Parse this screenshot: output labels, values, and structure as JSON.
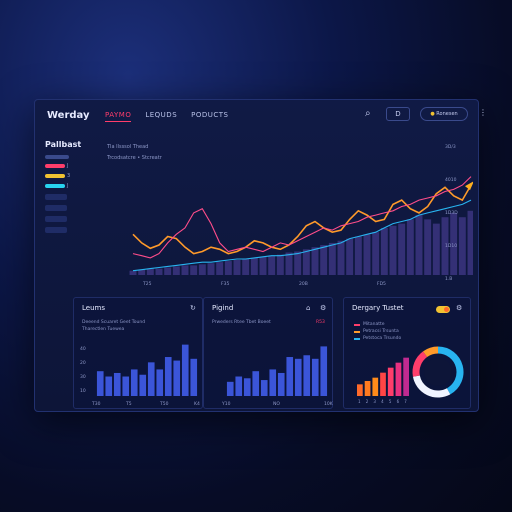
{
  "app": {
    "brand": "Werday",
    "nav": [
      {
        "label": "PAYMO",
        "active": true
      },
      {
        "label": "LEQUDS",
        "active": false
      },
      {
        "label": "PODUCTS",
        "active": false
      }
    ],
    "toolbar_button": "D",
    "user_pill": "Ronesen"
  },
  "sidebar": {
    "title": "Pallbast",
    "items": [
      {
        "color": "#ff3d6b",
        "mark": "J"
      },
      {
        "color": "#f1c232",
        "mark": "3"
      },
      {
        "color": "#28d3f0",
        "mark": "J"
      }
    ]
  },
  "main": {
    "heading": "Tla   Ilsssol  Thead",
    "subheading": "Trcodsatcre • Stcreatr",
    "x_ticks": [
      "T25",
      "F35",
      "20B",
      "FD5"
    ],
    "y_ticks": [
      "3D/3",
      "4010",
      "1D3D",
      "1D10",
      "1.B"
    ]
  },
  "panels": {
    "left_title": "Leums",
    "left_sub1": "Deeend  Scuaret  Geet Tound",
    "left_sub2": "Tharectlen  Tuewea",
    "left_y": [
      "40",
      "20",
      "30",
      "10"
    ],
    "left_x": [
      "T30",
      "T5",
      "T50",
      "K4"
    ],
    "middle_title": "Pigind",
    "middle_sub1": "Prweders  Rtee Tbet Boeet",
    "middle_badge": "R53",
    "middle_x": [
      "Y10",
      "NO",
      "10K"
    ],
    "right_title": "Dergary Tustet",
    "right_legend": [
      "Mitanatte",
      "Petracsi Trsunta",
      "Petstoca Trsundo"
    ],
    "right_x": [
      "1",
      "2",
      "3",
      "4",
      "5",
      "6",
      "7"
    ]
  },
  "chart_data": [
    {
      "type": "line",
      "title": "",
      "xlabel": "",
      "ylabel": "",
      "x": [
        1,
        2,
        3,
        4,
        5,
        6,
        7,
        8,
        9,
        10,
        11,
        12,
        13,
        14,
        15,
        16,
        17,
        18,
        19,
        20,
        21,
        22,
        23,
        24,
        25,
        26,
        27,
        28,
        29,
        30,
        31,
        32,
        33,
        34,
        35,
        36,
        37,
        38,
        39,
        40
      ],
      "ylim": [
        0,
        100
      ],
      "series": [
        {
          "values": [
            38,
            30,
            25,
            28,
            36,
            34,
            26,
            20,
            22,
            26,
            24,
            20,
            22,
            26,
            32,
            30,
            26,
            24,
            28,
            36,
            46,
            50,
            44,
            40,
            42,
            52,
            60,
            56,
            50,
            52,
            66,
            70,
            62,
            58,
            64,
            76,
            82,
            74,
            70,
            84
          ],
          "color": "#ff9a2a"
        },
        {
          "values": [
            20,
            18,
            16,
            20,
            30,
            38,
            44,
            58,
            62,
            48,
            30,
            22,
            24,
            26,
            24,
            22,
            26,
            30,
            28,
            32,
            36,
            40,
            44,
            42,
            46,
            48,
            50,
            54,
            56,
            58,
            60,
            64,
            66,
            70,
            72,
            74,
            78,
            80,
            84,
            92
          ],
          "color": "#ff4d8a"
        },
        {
          "values": [
            4,
            5,
            6,
            7,
            8,
            9,
            10,
            11,
            12,
            12,
            13,
            14,
            15,
            15,
            16,
            17,
            18,
            18,
            19,
            20,
            22,
            24,
            26,
            28,
            30,
            34,
            36,
            38,
            40,
            44,
            48,
            50,
            52,
            56,
            58,
            60,
            62,
            64,
            66,
            70
          ],
          "color": "#28b4f0"
        }
      ],
      "bars": [
        4,
        5,
        6,
        6,
        7,
        8,
        9,
        9,
        10,
        11,
        12,
        13,
        14,
        15,
        16,
        17,
        18,
        19,
        21,
        22,
        24,
        26,
        28,
        30,
        32,
        34,
        36,
        38,
        40,
        44,
        46,
        48,
        52,
        56,
        52,
        48,
        54,
        58,
        54,
        60
      ]
    },
    {
      "type": "bar",
      "series": [
        {
          "values": [
            28,
            22,
            26,
            22,
            30,
            24,
            38,
            30,
            44,
            40,
            58,
            42
          ]
        }
      ],
      "ylim": [
        0,
        70
      ]
    },
    {
      "type": "bar",
      "series": [
        {
          "values": [
            16,
            22,
            20,
            28,
            18,
            30,
            26,
            44,
            42,
            46,
            42,
            56
          ]
        }
      ],
      "ylim": [
        0,
        70
      ]
    },
    {
      "type": "bar",
      "series": [
        {
          "values": [
            14,
            18,
            22,
            28,
            34,
            40,
            46
          ]
        }
      ],
      "colors": [
        "#ff6a2a",
        "#ff7a1f",
        "#ff8b1a",
        "#ff4545",
        "#ff3d6b",
        "#e83080",
        "#c02a90"
      ],
      "ylim": [
        0,
        60
      ]
    },
    {
      "type": "pie",
      "series": [
        {
          "values": [
            42,
            30,
            18,
            10
          ]
        }
      ],
      "colors": [
        "#28b4f0",
        "#f1f4ff",
        "#ff3d6b",
        "#ff9a2a"
      ]
    }
  ]
}
